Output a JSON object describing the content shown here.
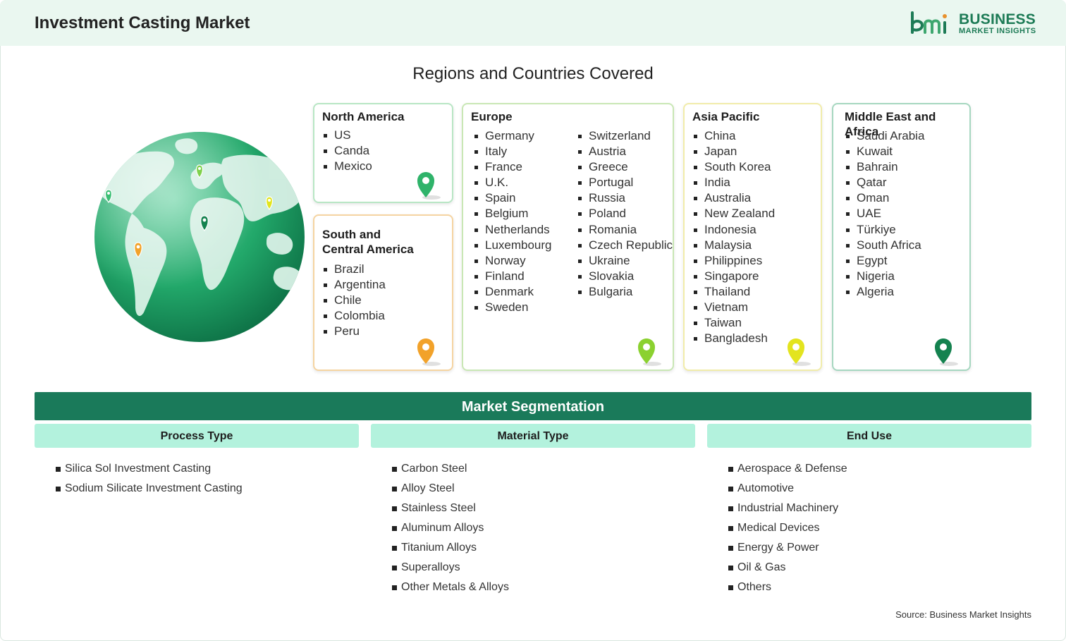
{
  "header": {
    "title": "Investment Casting Market",
    "logo_word1": "BUSINESS",
    "logo_word2": "MARKET INSIGHTS"
  },
  "regions": {
    "title": "Regions and Countries Covered",
    "north_america": {
      "title": "North America",
      "items": [
        "US",
        "Canda",
        "Mexico"
      ],
      "pin_color": "#2fb36a"
    },
    "south_central_america": {
      "title_line1": "South and",
      "title_line2": "Central America",
      "items": [
        "Brazil",
        "Argentina",
        "Chile",
        "Colombia",
        "Peru"
      ],
      "pin_color": "#f2a22a"
    },
    "europe": {
      "title": "Europe",
      "col1": [
        "Germany",
        "Italy",
        "France",
        "U.K.",
        "Spain",
        "Belgium",
        "Netherlands",
        "Luxembourg",
        "Norway",
        "Finland",
        "Denmark",
        "Sweden"
      ],
      "col2": [
        "Switzerland",
        "Austria",
        "Greece",
        "Portugal",
        "Russia",
        "Poland",
        "Romania",
        "Czech Republic",
        "Ukraine",
        "Slovakia",
        "Bulgaria"
      ],
      "pin_color": "#8bd130"
    },
    "asia_pacific": {
      "title": "Asia Pacific",
      "items": [
        "China",
        "Japan",
        "South Korea",
        "India",
        "Australia",
        "New Zealand",
        "Indonesia",
        "Malaysia",
        "Philippines",
        "Singapore",
        "Thailand",
        "Vietnam",
        "Taiwan",
        "Bangladesh"
      ],
      "pin_color": "#e3e41f"
    },
    "middle_east_africa": {
      "title": "Middle East and Africa",
      "items": [
        "Saudi Arabia",
        "Kuwait",
        "Bahrain",
        "Qatar",
        "Oman",
        "UAE",
        "Türkiye",
        "South Africa",
        "Egypt",
        "Nigeria",
        "Algeria"
      ],
      "pin_color": "#14824f"
    }
  },
  "segmentation": {
    "title": "Market Segmentation",
    "process_type": {
      "title": "Process Type",
      "items": [
        "Silica Sol Investment Casting",
        "Sodium Silicate Investment Casting"
      ]
    },
    "material_type": {
      "title": "Material Type",
      "items": [
        "Carbon Steel",
        "Alloy Steel",
        "Stainless Steel",
        "Aluminum Alloys",
        "Titanium Alloys",
        "Superalloys",
        "Other Metals & Alloys"
      ]
    },
    "end_use": {
      "title": "End Use",
      "items": [
        "Aerospace & Defense",
        "Automotive",
        "Industrial Machinery",
        "Medical Devices",
        "Energy & Power",
        "Oil & Gas",
        "Others"
      ]
    }
  },
  "source": "Source: Business Market Insights",
  "colors": {
    "brand_green": "#1a7a5a",
    "header_bg": "#eaf7f0",
    "segment_head_bg": "#b3f2dd"
  }
}
